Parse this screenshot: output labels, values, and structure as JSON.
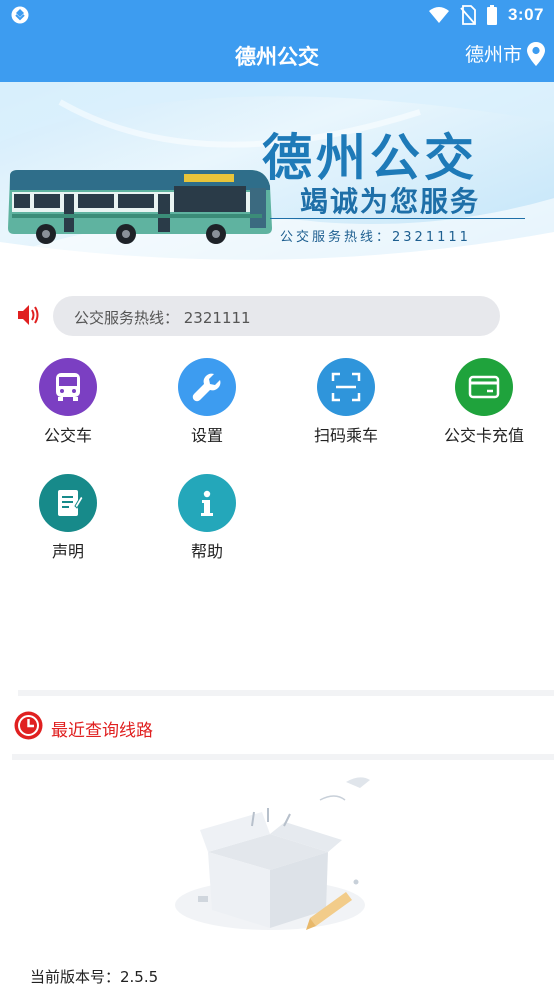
{
  "status_bar": {
    "time": "3:07",
    "left_icon": "app-notification-icon",
    "right_icons": [
      "wifi-icon",
      "no-sim-icon",
      "battery-icon"
    ]
  },
  "header": {
    "title": "德州公交",
    "city": "德州市",
    "city_icon": "location-pin-icon",
    "background_color": "#3d9cf0"
  },
  "banner": {
    "title": "德州公交",
    "slogan": "竭诚为您服务",
    "hotline": "公交服务热线：2321111"
  },
  "notice": {
    "icon": "speaker-icon",
    "text": "公交服务热线：  2321111"
  },
  "functions": [
    {
      "label": "公交车",
      "icon": "bus-icon",
      "color": "#7b3fc2"
    },
    {
      "label": "设置",
      "icon": "wrench-icon",
      "color": "#3d9cf0"
    },
    {
      "label": "扫码乘车",
      "icon": "scan-icon",
      "color": "#2f95db"
    },
    {
      "label": "公交卡充值",
      "icon": "card-icon",
      "color": "#1fa33c"
    },
    {
      "label": "声明",
      "icon": "document-icon",
      "color": "#178a8a"
    },
    {
      "label": "帮助",
      "icon": "info-icon",
      "color": "#24a7ba"
    }
  ],
  "recent": {
    "icon": "clock-icon",
    "label": "最近查询线路",
    "color": "#e02020",
    "empty_icon": "empty-box-icon"
  },
  "footer": {
    "version": "当前版本号：2.5.5"
  }
}
